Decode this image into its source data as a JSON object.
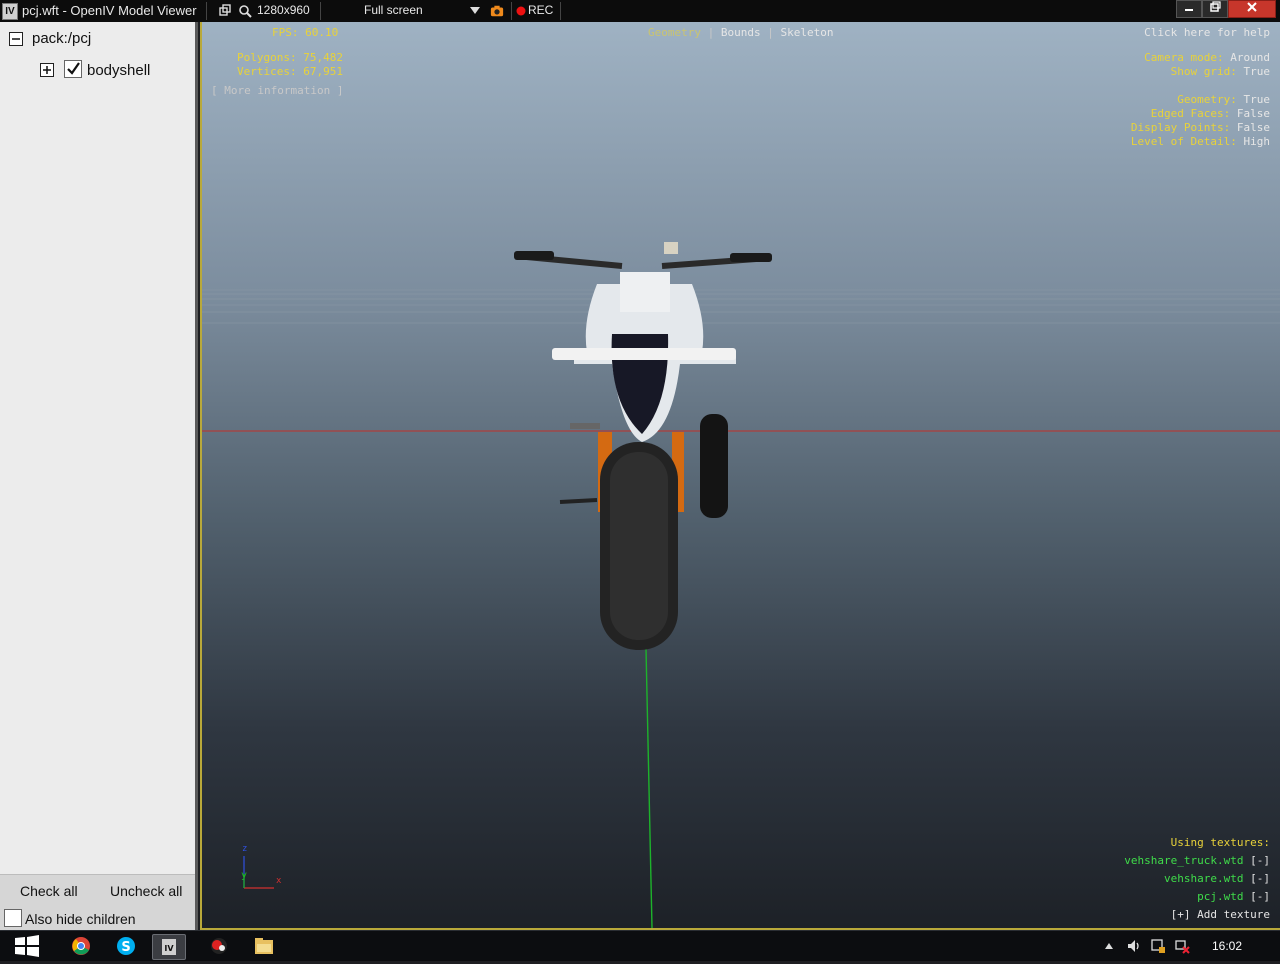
{
  "window": {
    "title": "pcj.wft - OpenIV Model Viewer",
    "resolution": "1280x960",
    "fullscreen_label": "Full screen",
    "rec_label": "REC"
  },
  "tree": {
    "root": "pack:/pcj",
    "child": "bodyshell",
    "child_checked": true
  },
  "footer": {
    "check_all": "Check all",
    "uncheck_all": "Uncheck all",
    "also_hide_children": "Also hide children"
  },
  "overlay": {
    "fps_label": "FPS:",
    "fps_value": "60.10",
    "polygons_label": "Polygons:",
    "polygons_value": "75,482",
    "vertices_label": "Vertices:",
    "vertices_value": "67,951",
    "more_info": "[ More information ]",
    "tabs": [
      "Geometry",
      "Bounds",
      "Skeleton"
    ],
    "active_tab": "Geometry",
    "help": "Click here for help",
    "camera_mode_label": "Camera mode:",
    "camera_mode_value": "Around",
    "show_grid_label": "Show grid:",
    "show_grid_value": "True",
    "geometry_label": "Geometry:",
    "geometry_value": "True",
    "edged_faces_label": "Edged Faces:",
    "edged_faces_value": "False",
    "display_points_label": "Display Points:",
    "display_points_value": "False",
    "lod_label": "Level of Detail:",
    "lod_value": "High",
    "using_textures": "Using textures:",
    "textures": [
      "vehshare_truck.wtd",
      "vehshare.wtd",
      "pcj.wtd"
    ],
    "remove_token": "[-]",
    "add_texture": "[+] Add texture",
    "axis_y": "y",
    "axis_x": "x",
    "axis_z": "z"
  },
  "taskbar": {
    "clock": "16:02"
  },
  "colors": {
    "overlay_yellow": "#e8d23a",
    "overlay_green": "#3fdc4a",
    "viewport_border": "#b9a93a"
  }
}
